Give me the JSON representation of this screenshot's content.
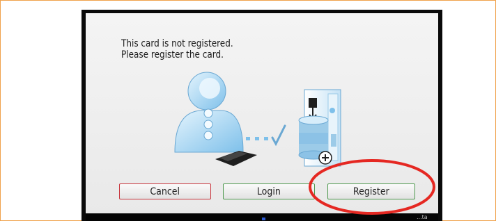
{
  "message": {
    "line1": "This card is not registered.",
    "line2": "Please register the card."
  },
  "buttons": {
    "cancel": "Cancel",
    "login": "Login",
    "register": "Register"
  },
  "status": {
    "corner_text": "...ta"
  },
  "colors": {
    "frame": "#f0a14a",
    "cancel_border": "#c8353d",
    "ok_border": "#4f9a4f",
    "annotation": "#e52822",
    "illustration_blue": "#7ec0ea"
  },
  "icons": {
    "user": "user-card-icon",
    "server": "server-database-icon",
    "check": "checkmark-icon"
  }
}
